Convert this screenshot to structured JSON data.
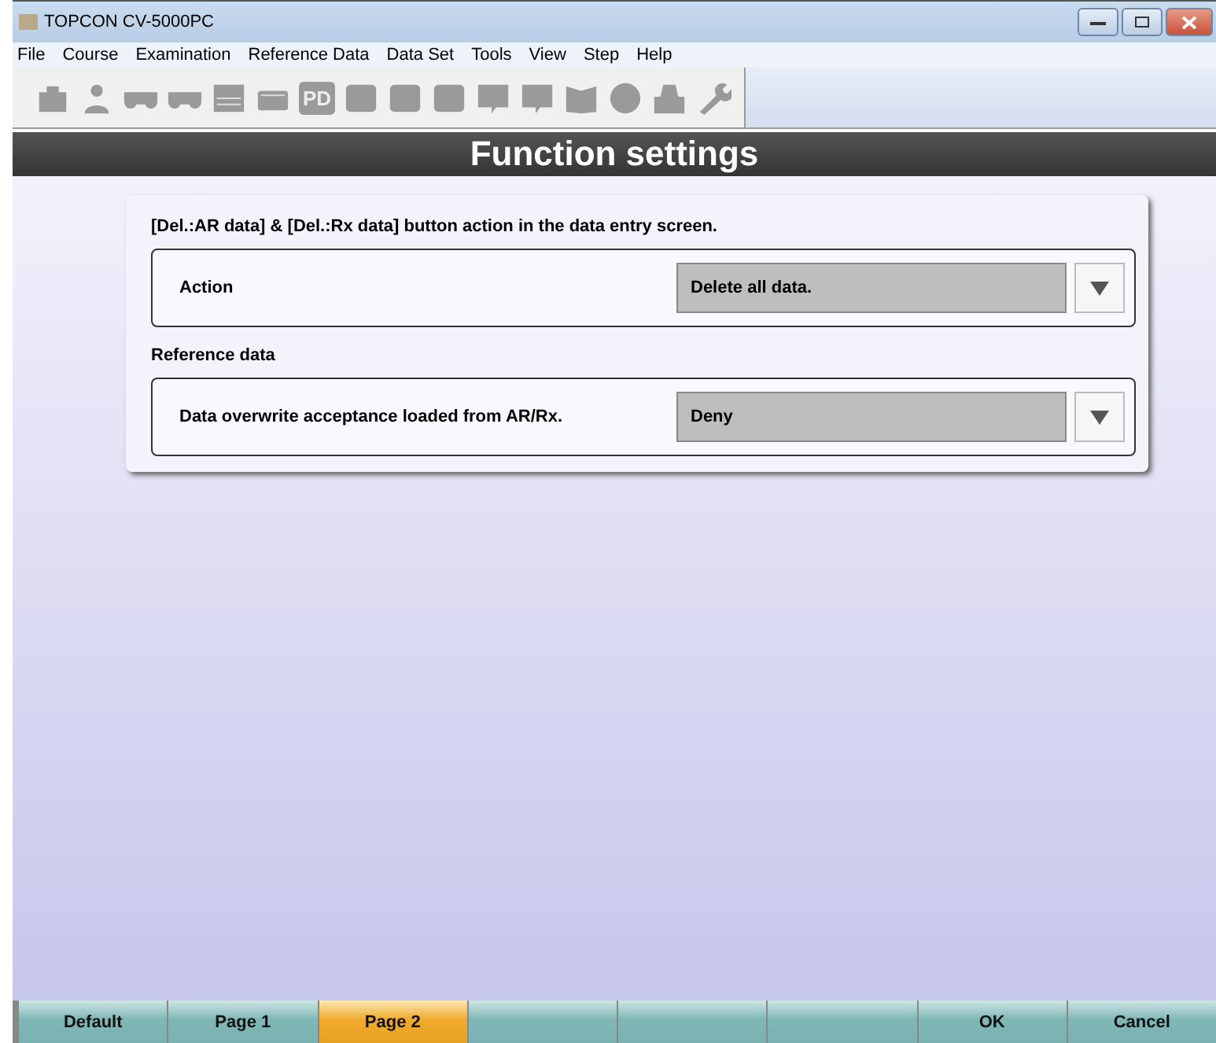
{
  "window": {
    "title": "TOPCON CV-5000PC"
  },
  "menu": [
    "File",
    "Course",
    "Examination",
    "Reference Data",
    "Data Set",
    "Tools",
    "View",
    "Step",
    "Help"
  ],
  "toolbar": [
    {
      "kind": "case"
    },
    {
      "kind": "person"
    },
    {
      "kind": "eyes"
    },
    {
      "kind": "eyes"
    },
    {
      "kind": "chart"
    },
    {
      "kind": "tray"
    },
    {
      "kind": "text",
      "label": "PD"
    },
    {
      "kind": "square"
    },
    {
      "kind": "square"
    },
    {
      "kind": "square"
    },
    {
      "kind": "bubble"
    },
    {
      "kind": "bubble"
    },
    {
      "kind": "book"
    },
    {
      "kind": "circle"
    },
    {
      "kind": "bag"
    },
    {
      "kind": "wrench"
    }
  ],
  "header": "Function settings",
  "sections": [
    {
      "title": "[Del.:AR data] & [Del.:Rx data] button action in the data entry screen.",
      "label": "Action",
      "value": "Delete all data."
    },
    {
      "title": "Reference data",
      "label": "Data overwrite acceptance loaded from AR/Rx.",
      "value": "Deny"
    }
  ],
  "buttons": [
    {
      "label": "Default",
      "selected": false
    },
    {
      "label": "Page 1",
      "selected": false
    },
    {
      "label": "Page 2",
      "selected": true
    },
    {
      "selected": false
    },
    {
      "selected": false
    },
    {
      "selected": false
    },
    {
      "label": "OK",
      "selected": false
    },
    {
      "label": "Cancel",
      "selected": false
    }
  ]
}
